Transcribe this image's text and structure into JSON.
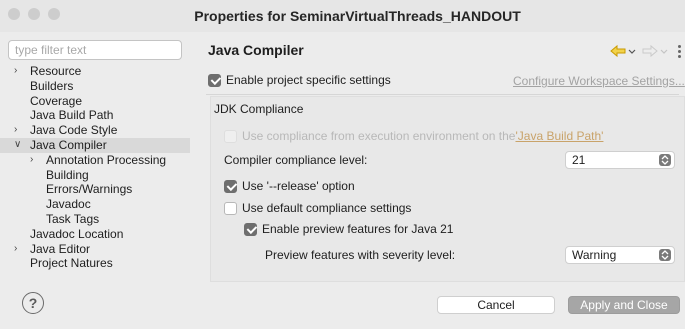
{
  "window": {
    "title": "Properties for SeminarVirtualThreads_HANDOUT"
  },
  "sidebar": {
    "filter_placeholder": "type filter text",
    "items": [
      {
        "label": "Resource",
        "level": 0,
        "expander": "collapsed"
      },
      {
        "label": "Builders",
        "level": 0,
        "expander": "none"
      },
      {
        "label": "Coverage",
        "level": 0,
        "expander": "none"
      },
      {
        "label": "Java Build Path",
        "level": 0,
        "expander": "none"
      },
      {
        "label": "Java Code Style",
        "level": 0,
        "expander": "collapsed"
      },
      {
        "label": "Java Compiler",
        "level": 0,
        "expander": "expanded",
        "selected": true
      },
      {
        "label": "Annotation Processing",
        "level": 1,
        "expander": "collapsed"
      },
      {
        "label": "Building",
        "level": 1,
        "expander": "none"
      },
      {
        "label": "Errors/Warnings",
        "level": 1,
        "expander": "none"
      },
      {
        "label": "Javadoc",
        "level": 1,
        "expander": "none"
      },
      {
        "label": "Task Tags",
        "level": 1,
        "expander": "none"
      },
      {
        "label": "Javadoc Location",
        "level": 0,
        "expander": "none"
      },
      {
        "label": "Java Editor",
        "level": 0,
        "expander": "collapsed"
      },
      {
        "label": "Project Natures",
        "level": 0,
        "expander": "none"
      }
    ]
  },
  "page": {
    "title": "Java Compiler",
    "enable_project_settings": {
      "label": "Enable project specific settings",
      "checked": true
    },
    "configure_link": "Configure Workspace Settings...",
    "jdk_compliance": {
      "title": "JDK Compliance",
      "use_env_compliance": {
        "prefix": "Use compliance from execution environment on the ",
        "link": "'Java Build Path'",
        "checked": false,
        "disabled": true
      },
      "compliance_level": {
        "label": "Compiler compliance level:",
        "value": "21"
      },
      "use_release_option": {
        "label": "Use '--release' option",
        "checked": true
      },
      "use_default_compliance": {
        "label": "Use default compliance settings",
        "checked": false
      },
      "enable_preview": {
        "label": "Enable preview features for Java 21",
        "checked": true
      },
      "preview_severity": {
        "label": "Preview features with severity level:",
        "value": "Warning"
      }
    }
  },
  "buttons": {
    "cancel": "Cancel",
    "apply_close": "Apply and Close",
    "help": "?"
  },
  "colors": {
    "accent_nav": "#e3b400",
    "selected_bg": "#d9d9d9",
    "checkbox_on": "#6e6e6e"
  },
  "icons": [
    "back-arrow-icon",
    "forward-arrow-icon",
    "view-menu-icon",
    "help-icon",
    "chevron-right-icon",
    "chevron-down-icon",
    "select-arrows-icon",
    "checkmark-icon"
  ]
}
